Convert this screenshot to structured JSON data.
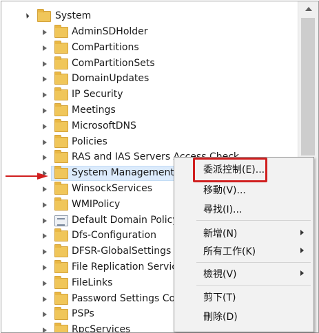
{
  "tree": {
    "root": {
      "label": "System"
    },
    "children": [
      {
        "label": "AdminSDHolder",
        "icon": "folder-icon"
      },
      {
        "label": "ComPartitions",
        "icon": "folder-icon"
      },
      {
        "label": "ComPartitionSets",
        "icon": "folder-icon"
      },
      {
        "label": "DomainUpdates",
        "icon": "folder-icon"
      },
      {
        "label": "IP Security",
        "icon": "folder-icon"
      },
      {
        "label": "Meetings",
        "icon": "folder-icon"
      },
      {
        "label": "MicrosoftDNS",
        "icon": "folder-icon"
      },
      {
        "label": "Policies",
        "icon": "folder-icon"
      },
      {
        "label": "RAS and IAS Servers Access Check",
        "icon": "folder-icon"
      },
      {
        "label": "System Management",
        "icon": "folder-icon",
        "selected": true
      },
      {
        "label": "WinsockServices",
        "icon": "folder-icon"
      },
      {
        "label": "WMIPolicy",
        "icon": "folder-icon"
      },
      {
        "label": "Default Domain Policy",
        "icon": "policy-icon"
      },
      {
        "label": "Dfs-Configuration",
        "icon": "folder-icon"
      },
      {
        "label": "DFSR-GlobalSettings",
        "icon": "folder-icon"
      },
      {
        "label": "File Replication Service",
        "icon": "folder-icon"
      },
      {
        "label": "FileLinks",
        "icon": "folder-icon"
      },
      {
        "label": "Password Settings Container",
        "icon": "folder-icon"
      },
      {
        "label": "PSPs",
        "icon": "folder-icon"
      },
      {
        "label": "RpcServices",
        "icon": "folder-icon"
      }
    ]
  },
  "context_menu": {
    "items": [
      {
        "label": "委派控制(E)...",
        "submenu": false,
        "highlighted": true
      },
      {
        "label": "移動(V)...",
        "submenu": false
      },
      {
        "label": "尋找(I)...",
        "submenu": false
      },
      {
        "label": "新增(N)",
        "submenu": true
      },
      {
        "label": "所有工作(K)",
        "submenu": true
      },
      {
        "label": "檢視(V)",
        "submenu": true
      },
      {
        "label": "剪下(T)",
        "submenu": false
      },
      {
        "label": "刪除(D)",
        "submenu": false
      }
    ]
  },
  "colors": {
    "annotation_red": "#d01f1f",
    "folder_yellow": "#f0c65a",
    "selection": "#dcebfc"
  }
}
